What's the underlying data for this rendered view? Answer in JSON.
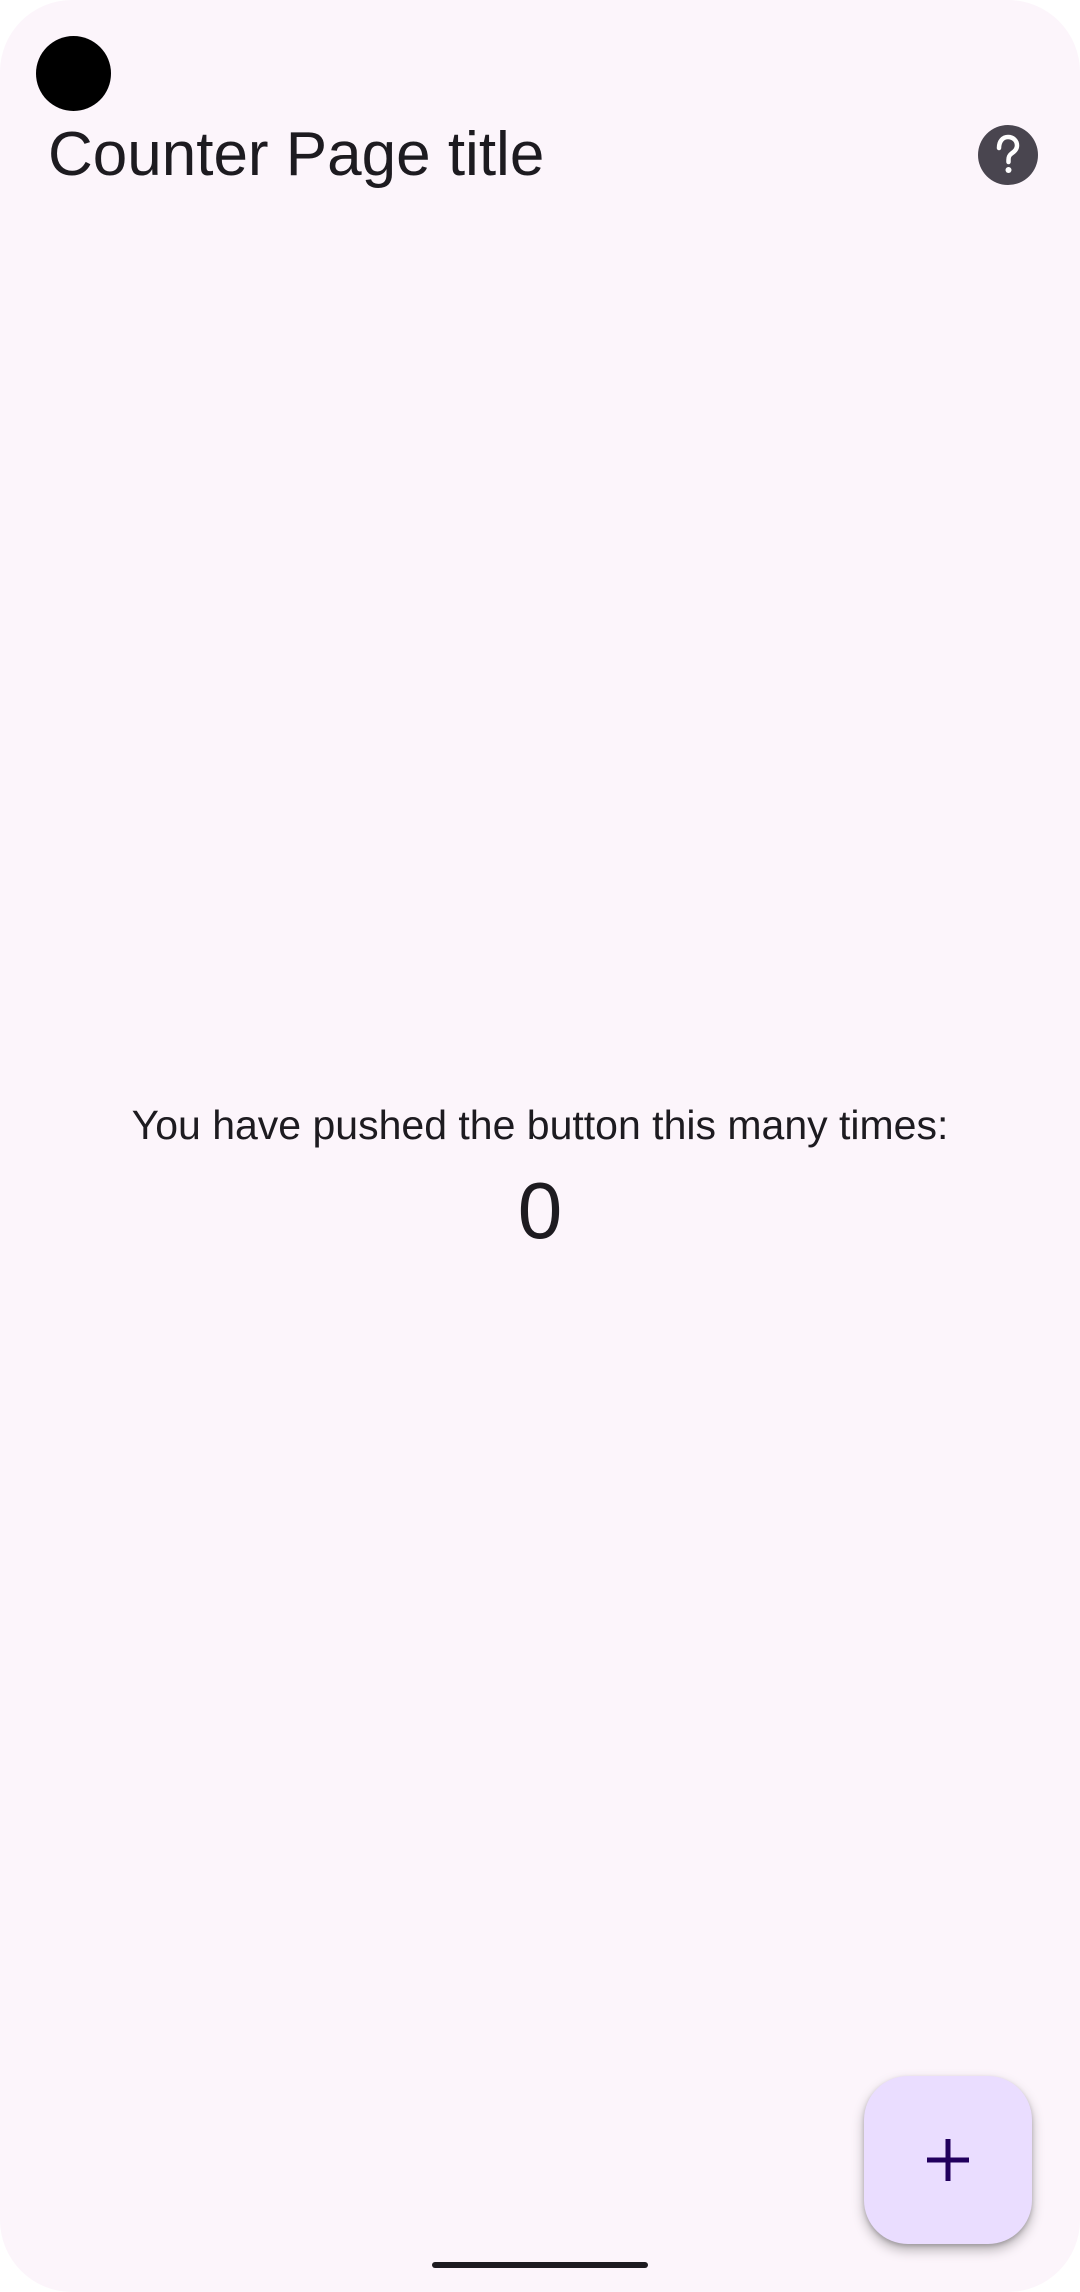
{
  "app_bar": {
    "title": "Counter Page title",
    "help_icon": "help-circle-icon"
  },
  "main": {
    "counter_label": "You have pushed the button this many times:",
    "counter_value": "0"
  },
  "fab": {
    "icon": "plus-icon"
  },
  "colors": {
    "background": "#fcf5fb",
    "text": "#1d1b20",
    "fab_background": "#eaddff",
    "fab_icon": "#21005d",
    "help_icon_background": "#49454f"
  }
}
